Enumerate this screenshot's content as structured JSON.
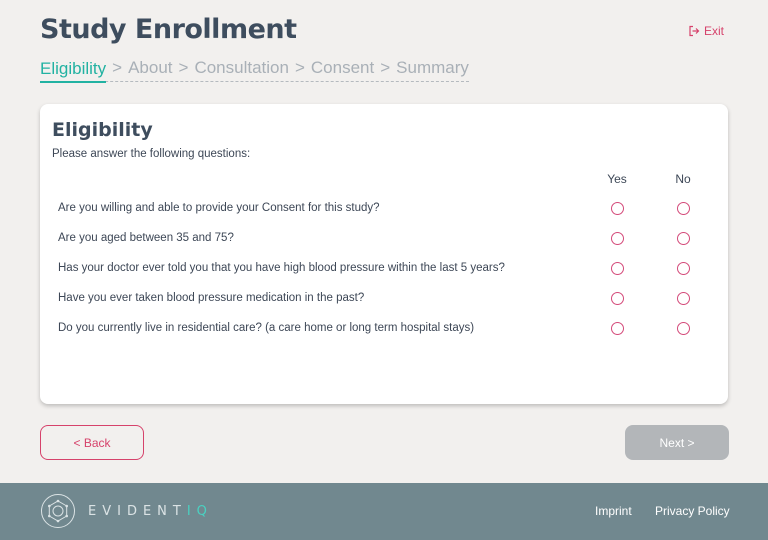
{
  "header": {
    "title": "Study Enrollment",
    "exit_label": "Exit"
  },
  "breadcrumb": {
    "items": [
      "Eligibility",
      "About",
      "Consultation",
      "Consent",
      "Summary"
    ],
    "separator": ">",
    "active": "Eligibility"
  },
  "card": {
    "title": "Eligibility",
    "subtitle": "Please answer the following questions:",
    "col_yes": "Yes",
    "col_no": "No",
    "questions": [
      "Are you willing and able to provide your Consent for this study?",
      "Are you aged between 35 and 75?",
      "Has your doctor ever told you that you have high blood pressure within the last 5 years?",
      "Have you ever taken blood pressure medication in the past?",
      "Do you currently live in residential care? (a care home or long term hospital stays)"
    ]
  },
  "nav": {
    "back_label": "< Back",
    "next_label": "Next >"
  },
  "footer": {
    "logo_text_main": "EVIDENT",
    "logo_text_accent": "IQ",
    "imprint": "Imprint",
    "privacy": "Privacy Policy"
  },
  "colors": {
    "accent_teal": "#22b2a2",
    "accent_pink": "#d6426b",
    "footer_bg": "#71888f",
    "disabled_button": "#b3b6b9"
  },
  "icons": {
    "exit": "exit-icon",
    "logo": "evidentiq-logo-icon"
  }
}
